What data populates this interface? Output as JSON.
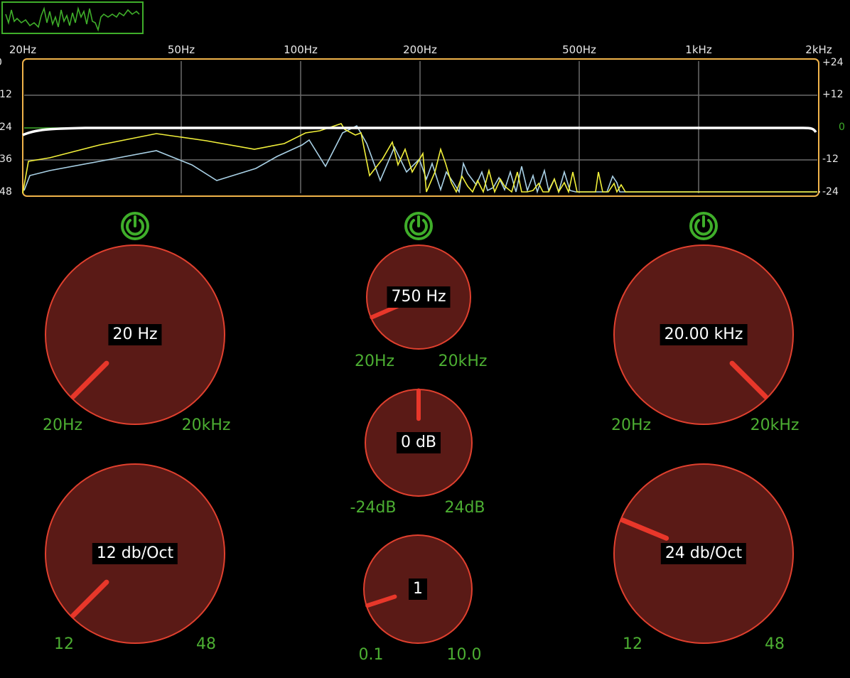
{
  "mini_meter": {
    "color": "#3fae2a"
  },
  "spectrum": {
    "freq_labels": [
      "20Hz",
      "50Hz",
      "100Hz",
      "200Hz",
      "500Hz",
      "1kHz",
      "2kHz"
    ],
    "db_left": [
      "0",
      "-12",
      "-24",
      "-36",
      "-48"
    ],
    "db_right": [
      "+24",
      "+12",
      "0",
      "-12",
      "-24"
    ],
    "colors": {
      "frame": "#f0b34a",
      "grid": "#6a6a6a",
      "curve": "#ffffff",
      "trace_a": "#f2f03a",
      "trace_b": "#a9d1e6",
      "zero": "#3fae2a"
    }
  },
  "low_band": {
    "power_icon": "power-icon",
    "freq": {
      "value": "20 Hz",
      "min": "20Hz",
      "max": "20kHz",
      "level": 0.0
    },
    "slope": {
      "value": "12 db/Oct",
      "min": "12",
      "max": "48",
      "level": 0.0
    }
  },
  "mid_band": {
    "power_icon": "power-icon",
    "freq": {
      "value": "750 Hz",
      "min": "20Hz",
      "max": "20kHz",
      "level": 0.08
    },
    "gain": {
      "value": "0 dB",
      "min": "-24dB",
      "max": "24dB",
      "level": 0.5
    },
    "q": {
      "value": "1",
      "min": "0.1",
      "max": "10.0",
      "level": 0.1
    }
  },
  "high_band": {
    "power_icon": "power-icon",
    "freq": {
      "value": "20.00 kHz",
      "min": "20Hz",
      "max": "20kHz",
      "level": 1.0
    },
    "slope": {
      "value": "24 db/Oct",
      "min": "12",
      "max": "48",
      "level": 0.25
    }
  },
  "theme": {
    "knob_fill": "#5a1a16",
    "knob_stroke": "#e0402e",
    "pointer": "#e8372a",
    "range_text": "#4cae32",
    "power": "#3fae2a"
  }
}
